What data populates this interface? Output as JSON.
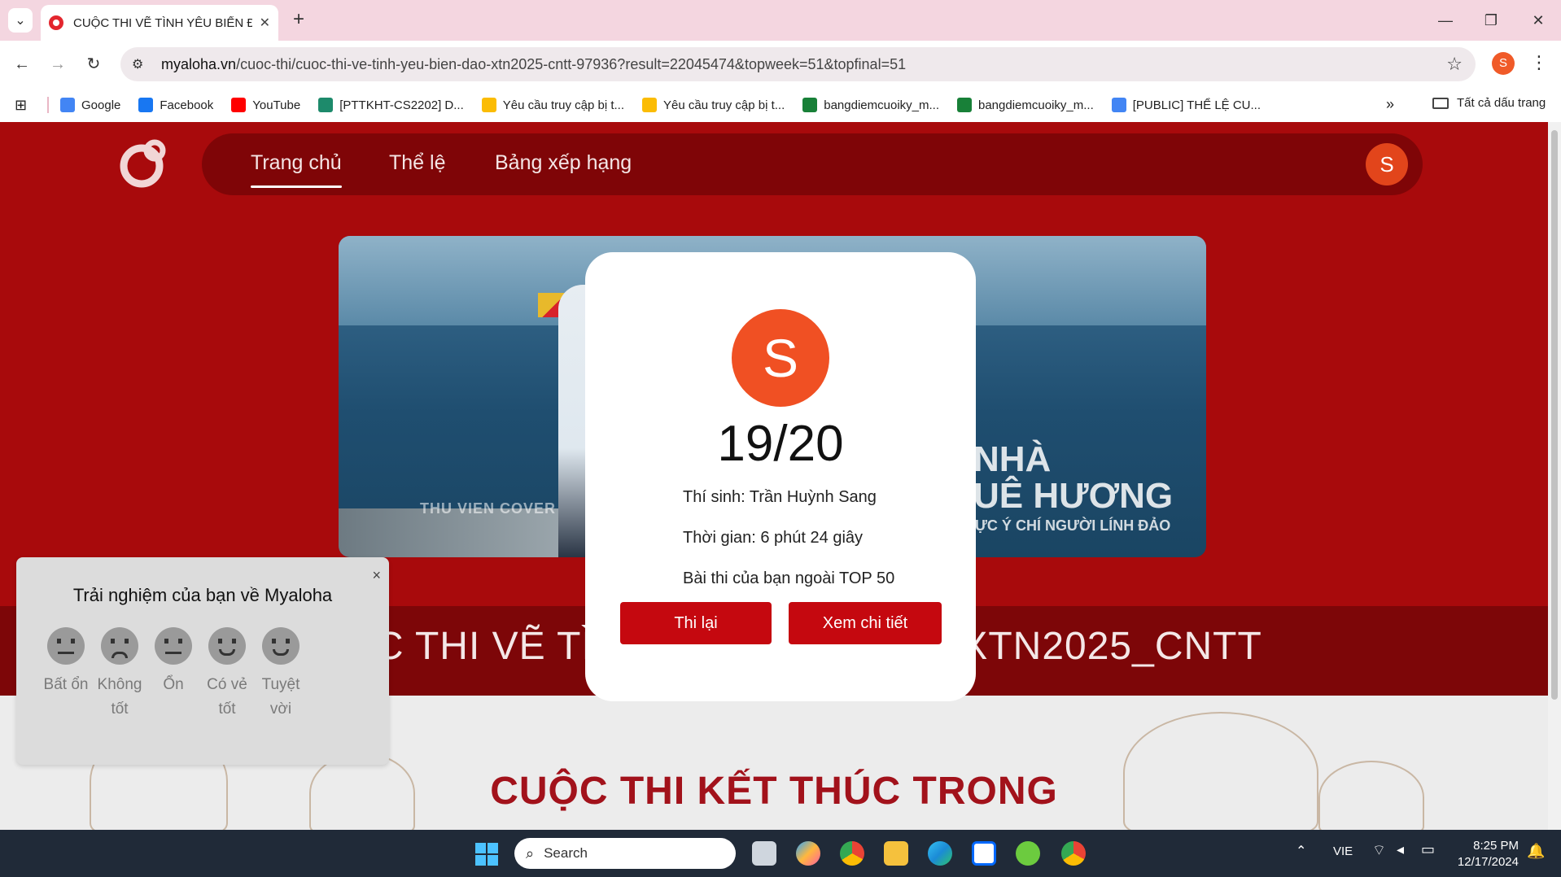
{
  "browser": {
    "tab_title": "CUỘC THI VẼ TÌNH YÊU BIỂN Đ",
    "url_host": "myaloha.vn",
    "url_path": "/cuoc-thi/cuoc-thi-ve-tinh-yeu-bien-dao-xtn2025-cntt-97936?result=22045474&topweek=51&topfinal=51",
    "profile_initial": "S",
    "bookmarks": [
      {
        "label": "Google",
        "icon_color": "#4285f4"
      },
      {
        "label": "Facebook",
        "icon_color": "#1877f2"
      },
      {
        "label": "YouTube",
        "icon_color": "#ff0000"
      },
      {
        "label": "[PTTKHT-CS2202] D...",
        "icon_color": "#1d8a6b"
      },
      {
        "label": "Yêu cầu truy cập bị t...",
        "icon_color": "#fbbc04"
      },
      {
        "label": "Yêu cầu truy cập bị t...",
        "icon_color": "#fbbc04"
      },
      {
        "label": "bangdiemcuoiky_m...",
        "icon_color": "#188038"
      },
      {
        "label": "bangdiemcuoiky_m...",
        "icon_color": "#188038"
      },
      {
        "label": "[PUBLIC] THỂ LỆ CU...",
        "icon_color": "#4285f4"
      }
    ],
    "all_bookmarks_label": "Tất cả dấu trang"
  },
  "site": {
    "nav": {
      "home": "Trang chủ",
      "rules": "Thể lệ",
      "ranking": "Bảng xếp hạng",
      "avatar_initial": "S"
    },
    "banner": {
      "watermark": "THU VIEN COVER",
      "line1": "NHÀ",
      "line2": "UÊ HƯƠNG",
      "line3": "ỰC Ý CHÍ NGƯỜI LÍNH ĐẢO"
    },
    "contest_title": "CUỘC THI VẼ TÌNH YÊU BIỂN ĐẢO XTN2025_CNTT",
    "ends_heading": "CUỘC THI KẾT THÚC TRONG"
  },
  "result_modal": {
    "avatar_initial": "S",
    "score": "19/20",
    "candidate": "Thí sinh: Trần Huỳnh Sang",
    "time": "Thời gian: 6 phút 24 giây",
    "rank_note": "Bài thi của bạn ngoài TOP 50",
    "retry_label": "Thi lại",
    "detail_label": "Xem chi tiết"
  },
  "feedback": {
    "title": "Trải nghiệm của bạn về Myaloha",
    "close": "×",
    "options": [
      {
        "label": "Bất ổn",
        "icon": "frustrated-face-icon"
      },
      {
        "label": "Không tốt",
        "icon": "sad-face-icon"
      },
      {
        "label": "Ổn",
        "icon": "neutral-face-icon"
      },
      {
        "label": "Có vẻ tốt",
        "icon": "grin-face-icon"
      },
      {
        "label": "Tuyệt vời",
        "icon": "heart-eyes-face-icon"
      }
    ]
  },
  "taskbar": {
    "search_placeholder": "Search",
    "language": "VIE",
    "time": "8:25 PM",
    "date": "12/17/2024"
  },
  "colors": {
    "hero_red": "#a80a0c",
    "nav_dark": "#7f0507",
    "button_red": "#c5080f",
    "avatar_orange": "#f05023"
  }
}
